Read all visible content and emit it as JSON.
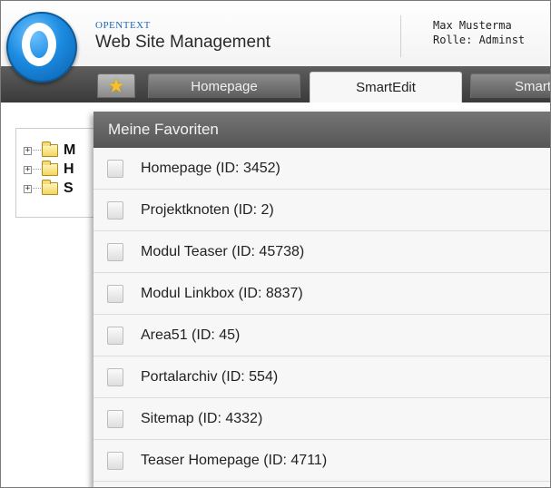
{
  "brand": {
    "company": "OPENTEXT",
    "product": "Web Site Management"
  },
  "user": {
    "name_line": "Max Musterma",
    "role_line": "Rolle: Adminst"
  },
  "tabs": [
    {
      "label": "Homepage",
      "active": false
    },
    {
      "label": "SmartEdit",
      "active": true
    },
    {
      "label": "Smart",
      "active": false
    }
  ],
  "favorites_button": {
    "icon": "star-icon",
    "color": "#f6c22b"
  },
  "tree": {
    "items": [
      {
        "label": "M"
      },
      {
        "label": "H"
      },
      {
        "label": "S"
      }
    ]
  },
  "favorites": {
    "title": "Meine Favoriten",
    "items": [
      {
        "label": "Homepage (ID: 3452)"
      },
      {
        "label": "Projektknoten (ID: 2)"
      },
      {
        "label": "Modul Teaser (ID: 45738)"
      },
      {
        "label": "Modul Linkbox (ID: 8837)"
      },
      {
        "label": "Area51 (ID: 45)"
      },
      {
        "label": "Portalarchiv (ID: 554)"
      },
      {
        "label": "Sitemap (ID: 4332)"
      },
      {
        "label": "Teaser Homepage (ID: 4711)"
      }
    ]
  }
}
